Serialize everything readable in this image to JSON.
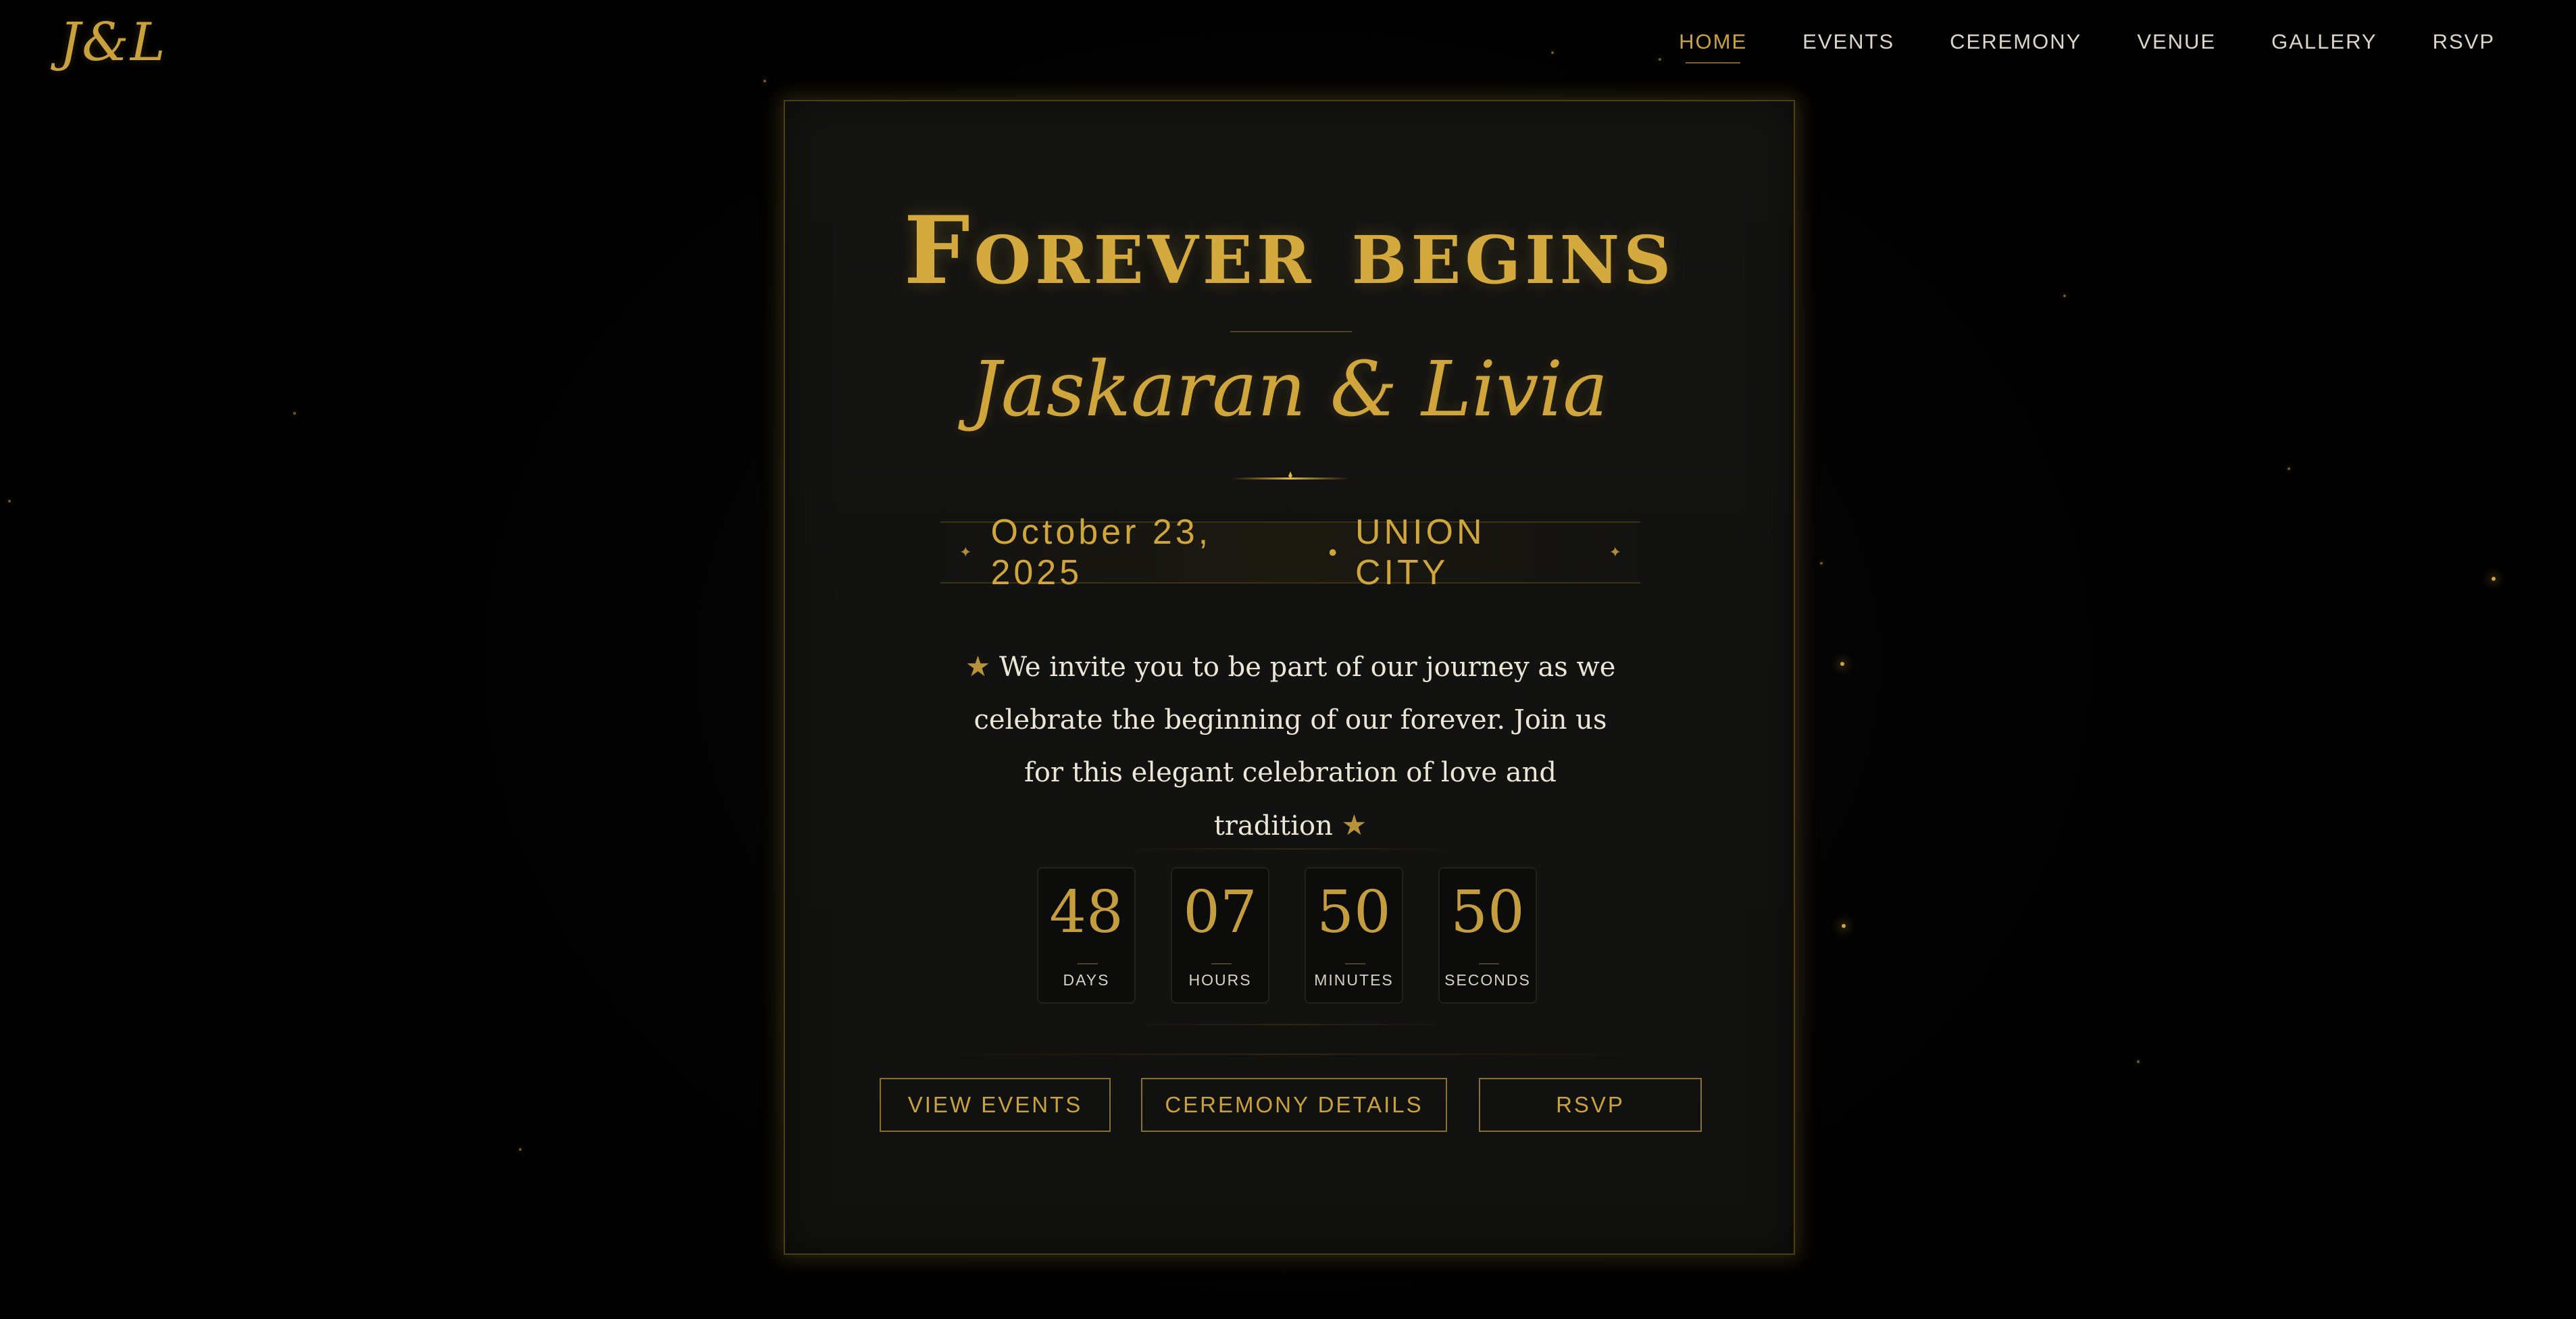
{
  "brand": {
    "logo_text": "J&L"
  },
  "nav": {
    "items": [
      {
        "label": "HOME"
      },
      {
        "label": "EVENTS"
      },
      {
        "label": "CEREMONY"
      },
      {
        "label": "VENUE"
      },
      {
        "label": "GALLERY"
      },
      {
        "label": "RSVP"
      }
    ],
    "active": "HOME"
  },
  "hero": {
    "title": "Forever begins",
    "names": "Jaskaran & Livia",
    "date": "October 23, 2025",
    "separator": "•",
    "location": "UNION CITY",
    "date_star": "✦",
    "invite_star": "★",
    "invite_text": "We invite you to be part of our journey as we celebrate the beginning of our forever. Join us for this elegant celebration of love and tradition"
  },
  "countdown": [
    {
      "value": "48",
      "label": "DAYS"
    },
    {
      "value": "07",
      "label": "HOURS"
    },
    {
      "value": "50",
      "label": "MINUTES"
    },
    {
      "value": "50",
      "label": "SECONDS"
    }
  ],
  "buttons": {
    "view_events": "VIEW EVENTS",
    "ceremony_details": "CEREMONY DETAILS",
    "rsvp": "RSVP"
  },
  "colors": {
    "accent_gold": "#c9a23e",
    "background": "#000000",
    "card": "#141411",
    "text": "#ece6d6"
  }
}
